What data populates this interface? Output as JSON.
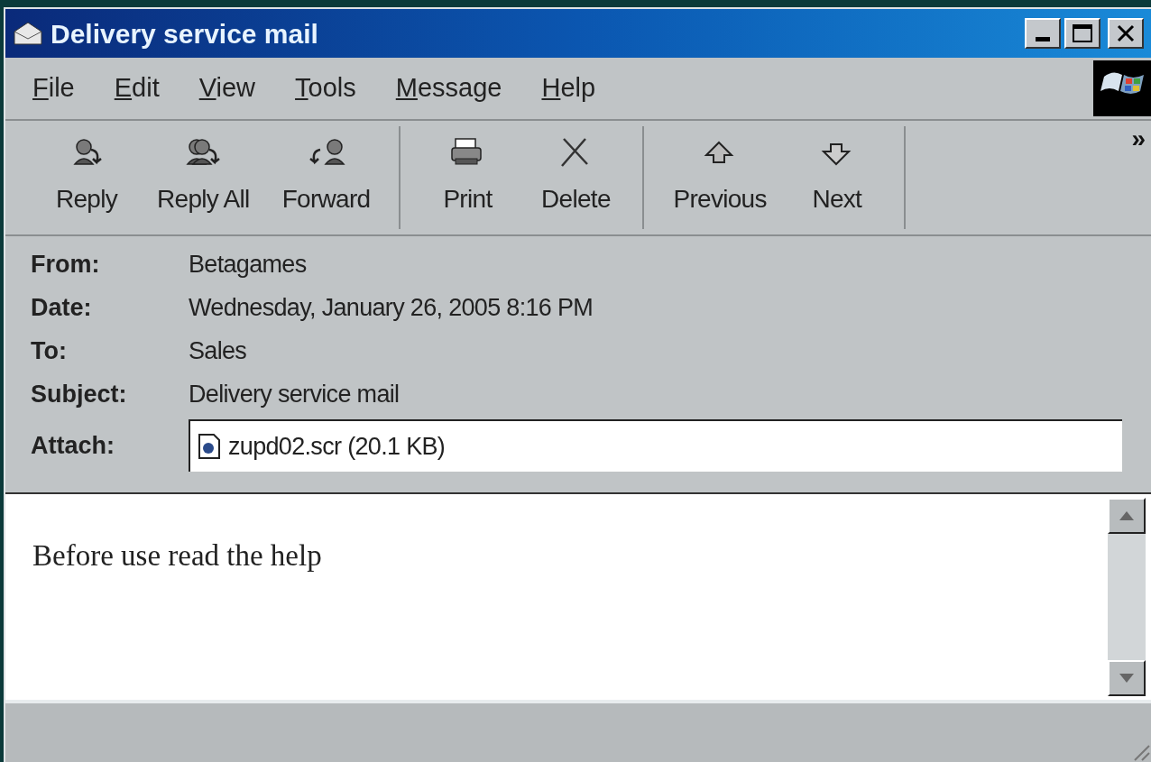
{
  "window": {
    "title": "Delivery service mail"
  },
  "menu": [
    "File",
    "Edit",
    "View",
    "Tools",
    "Message",
    "Help"
  ],
  "toolbar": {
    "groups": [
      [
        {
          "kind": "reply",
          "label": "Reply"
        },
        {
          "kind": "reply_all",
          "label": "Reply All"
        },
        {
          "kind": "forward",
          "label": "Forward"
        }
      ],
      [
        {
          "kind": "print",
          "label": "Print"
        },
        {
          "kind": "delete",
          "label": "Delete"
        }
      ],
      [
        {
          "kind": "previous",
          "label": "Previous"
        },
        {
          "kind": "next",
          "label": "Next"
        }
      ]
    ],
    "overflow": "»"
  },
  "headers": [
    {
      "label": "From:",
      "value": "Betagames"
    },
    {
      "label": "Date:",
      "value": "Wednesday, January 26, 2005 8:16 PM"
    },
    {
      "label": "To:",
      "value": "Sales"
    },
    {
      "label": "Subject:",
      "value": "Delivery service mail"
    }
  ],
  "attachment": {
    "label": "Attach:",
    "file": "zupd02.scr (20.1 KB)"
  },
  "body": "Before use read the help"
}
